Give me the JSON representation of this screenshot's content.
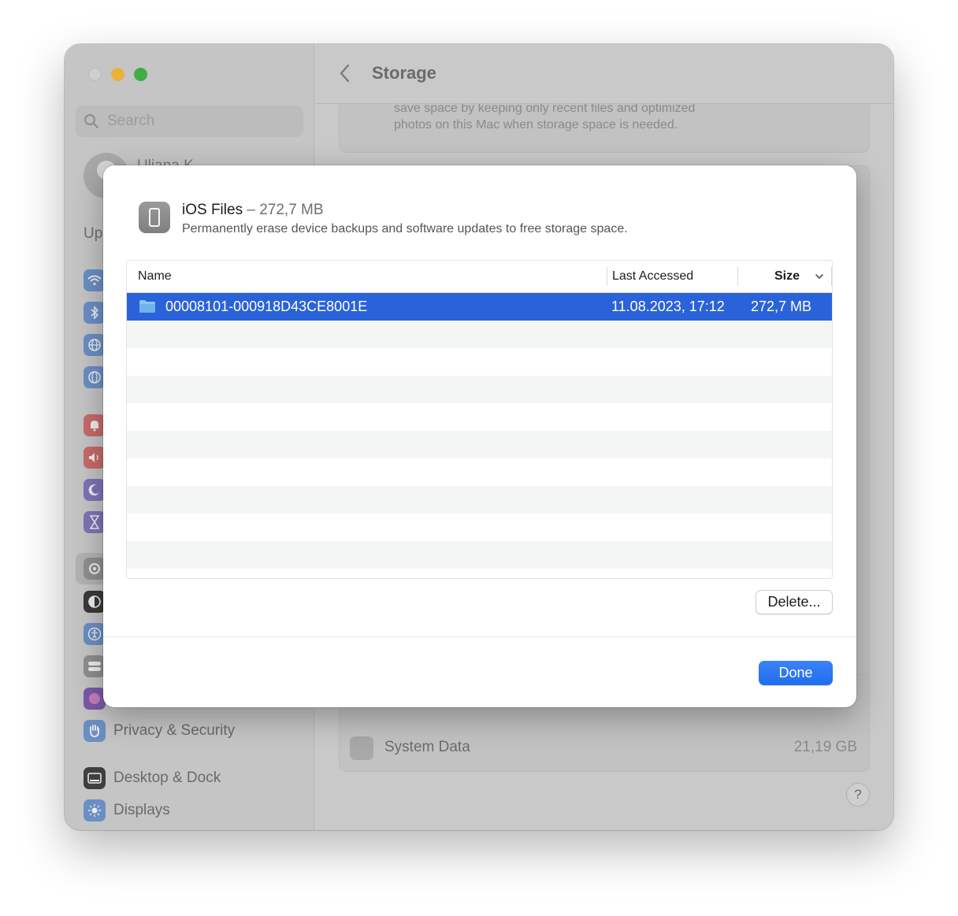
{
  "sidebar": {
    "search_placeholder": "Search",
    "profile_name": "Uliana K",
    "partial_section_text": "Up",
    "items": [
      {
        "label": "Privacy & Security",
        "icon": "hand-icon"
      },
      {
        "label": "Desktop & Dock",
        "icon": "dock-icon"
      },
      {
        "label": "Displays",
        "icon": "sun-icon"
      }
    ]
  },
  "main": {
    "title": "Storage",
    "card_text": "save space by keeping only recent files and optimized photos on this Mac when storage space is needed.",
    "system_data_label": "System Data",
    "system_data_size": "21,19 GB",
    "help_label": "?"
  },
  "sheet": {
    "title": "iOS Files",
    "title_separator": "–",
    "title_size": "272,7 MB",
    "subtitle": "Permanently erase device backups and software updates to free storage space.",
    "columns": {
      "name": "Name",
      "last_accessed": "Last Accessed",
      "size": "Size"
    },
    "rows": [
      {
        "name": "00008101-000918D43CE8001E",
        "last_accessed": "11.08.2023, 17:12",
        "size": "272,7 MB"
      }
    ],
    "delete_label": "Delete...",
    "done_label": "Done"
  },
  "colors": {
    "selection": "#2a62d9",
    "accent_button": "#1f6df0",
    "window_close": "#cfcfcf",
    "window_minimize": "#e8b23c",
    "window_zoom": "#3fae47"
  }
}
